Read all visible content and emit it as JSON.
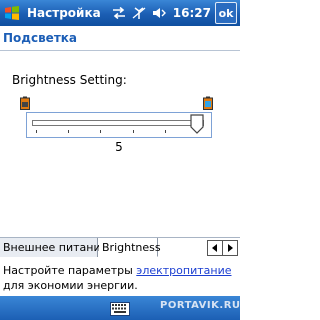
{
  "titlebar": {
    "title": "Настройка",
    "time": "16:27",
    "ok_label": "ok"
  },
  "header": {
    "title": "Подсветка"
  },
  "brightness": {
    "label": "Brightness Setting:",
    "value": "5",
    "level_fraction": 1.0
  },
  "tabs": [
    {
      "label": "Внешнее питание"
    },
    {
      "label": "Brightness"
    }
  ],
  "note": {
    "prefix": "Настройте параметры ",
    "link": "электропитание",
    "suffix": "для экономии энергии."
  },
  "watermark": "PORTAVIK.RU",
  "icons": {
    "start": "windows-flag-icon",
    "connectivity": "sync-arrows-icon",
    "no-signal": "antenna-off-icon",
    "volume": "speaker-icon",
    "dim": "battery-dim-icon",
    "bright": "battery-bright-icon",
    "keyboard": "keyboard-icon"
  }
}
